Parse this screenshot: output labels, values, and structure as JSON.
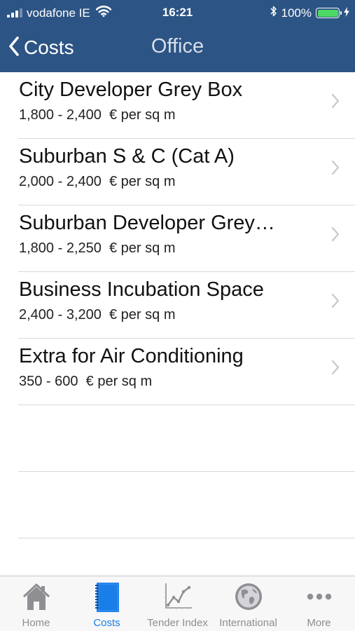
{
  "status_bar": {
    "carrier": "vodafone IE",
    "time": "16:21",
    "battery_percent": "100%",
    "battery_level": 1.0,
    "battery_color": "#4cd964"
  },
  "nav": {
    "back_label": "Costs",
    "title": "Office"
  },
  "list": {
    "items": [
      {
        "title": "City Developer Grey Box",
        "range": "1,800 - 2,400",
        "unit": "€ per sq m"
      },
      {
        "title": "Suburban S & C (Cat A)",
        "range": "2,000 - 2,400",
        "unit": "€ per sq m"
      },
      {
        "title": "Suburban Developer Grey…",
        "range": "1,800 - 2,250",
        "unit": "€ per sq m"
      },
      {
        "title": "Business Incubation Space",
        "range": "2,400 - 3,200",
        "unit": "€ per sq m"
      },
      {
        "title": "Extra for Air Conditioning",
        "range": "350 - 600",
        "unit": "€ per sq m"
      }
    ]
  },
  "tabbar": {
    "active": "Costs",
    "tabs": [
      {
        "label": "Home",
        "icon": "house-icon"
      },
      {
        "label": "Costs",
        "icon": "notebook-icon"
      },
      {
        "label": "Tender Index",
        "icon": "line-chart-icon"
      },
      {
        "label": "International",
        "icon": "globe-icon"
      },
      {
        "label": "More",
        "icon": "more-dots-icon"
      }
    ]
  },
  "colors": {
    "header_bg": "#2c5484",
    "tab_active": "#1a7ee8",
    "tab_inactive": "#8e8e93"
  }
}
